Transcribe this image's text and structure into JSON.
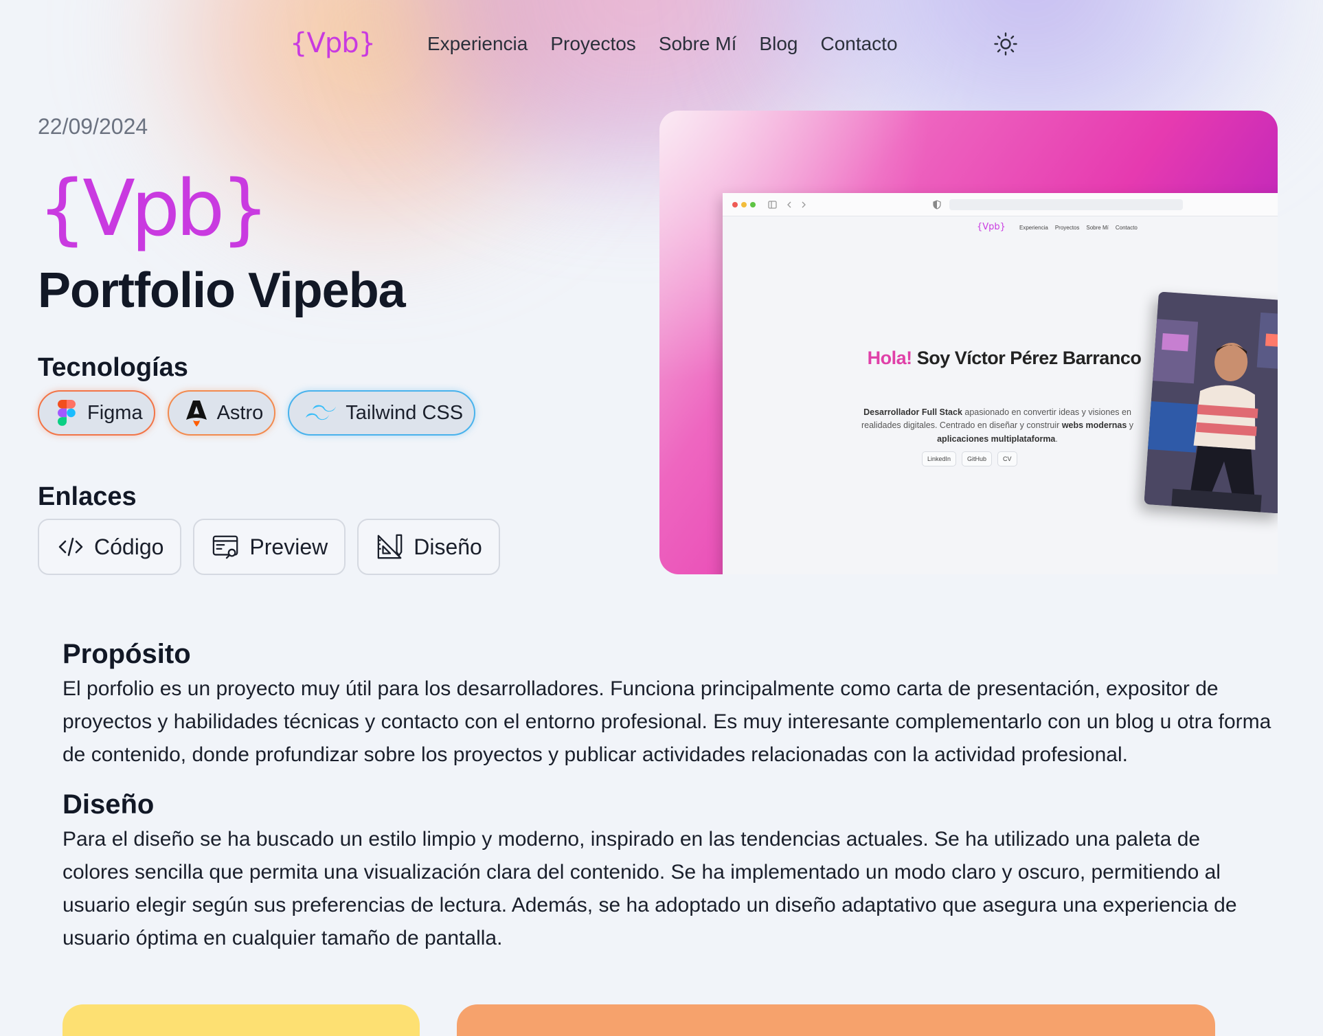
{
  "nav": {
    "logo": "{Vpb}",
    "links": [
      "Experiencia",
      "Proyectos",
      "Sobre Mí",
      "Blog",
      "Contacto"
    ],
    "theme_icon": "sun-icon"
  },
  "project": {
    "date": "22/09/2024",
    "logo": "{Vpb}",
    "title": "Portfolio Vipeba"
  },
  "tech": {
    "heading": "Tecnologías",
    "items": [
      {
        "label": "Figma",
        "icon": "figma-icon",
        "color": "#f27446"
      },
      {
        "label": "Astro",
        "icon": "astro-icon",
        "color": "#f28a4e"
      },
      {
        "label": "Tailwind CSS",
        "icon": "tailwind-icon",
        "color": "#48b2ec"
      }
    ]
  },
  "links": {
    "heading": "Enlaces",
    "items": [
      {
        "label": "Código",
        "icon": "code-icon"
      },
      {
        "label": "Preview",
        "icon": "preview-icon"
      },
      {
        "label": "Diseño",
        "icon": "design-icon"
      }
    ]
  },
  "preview": {
    "mini_logo": "{Vpb}",
    "mini_links": [
      "Experiencia",
      "Proyectos",
      "Sobre Mí",
      "Contacto"
    ],
    "hola": "Hola!",
    "name": "Soy Víctor Pérez Barranco",
    "sub_1": "Desarrollador Full Stack",
    "sub_2": "apasionado en convertir ideas y visiones en realidades digitales. Centrado en diseñar y construir",
    "sub_3": "webs modernas",
    "sub_4": "y",
    "sub_5": "aplicaciones multiplataforma",
    "sub_6": ".",
    "buttons": [
      "LinkedIn",
      "GitHub",
      "CV"
    ]
  },
  "sections": [
    {
      "heading": "Propósito",
      "text": "El porfolio es un proyecto muy útil para los desarrolladores. Funciona principalmente como carta de presentación, expositor de proyectos y habilidades técnicas y contacto con el entorno profesional. Es muy interesante complementarlo con un blog u otra forma de contenido, donde profundizar sobre los proyectos y publicar actividades relacionadas con la actividad profesional."
    },
    {
      "heading": "Diseño",
      "text": "Para el diseño se ha buscado un estilo limpio y moderno, inspirado en las tendencias actuales. Se ha utilizado una paleta de colores sencilla que permita una visualización clara del contenido. Se ha implementado un modo claro y oscuro, permitiendo al usuario elegir según sus preferencias de lectura. Además, se ha adoptado un diseño adaptativo que asegura una experiencia de usuario óptima en cualquier tamaño de pantalla."
    }
  ],
  "colors": {
    "accent": "#c93ae0",
    "background": "#f1f4f9",
    "card_yellow": "#fde072",
    "card_orange": "#f6a26c"
  }
}
